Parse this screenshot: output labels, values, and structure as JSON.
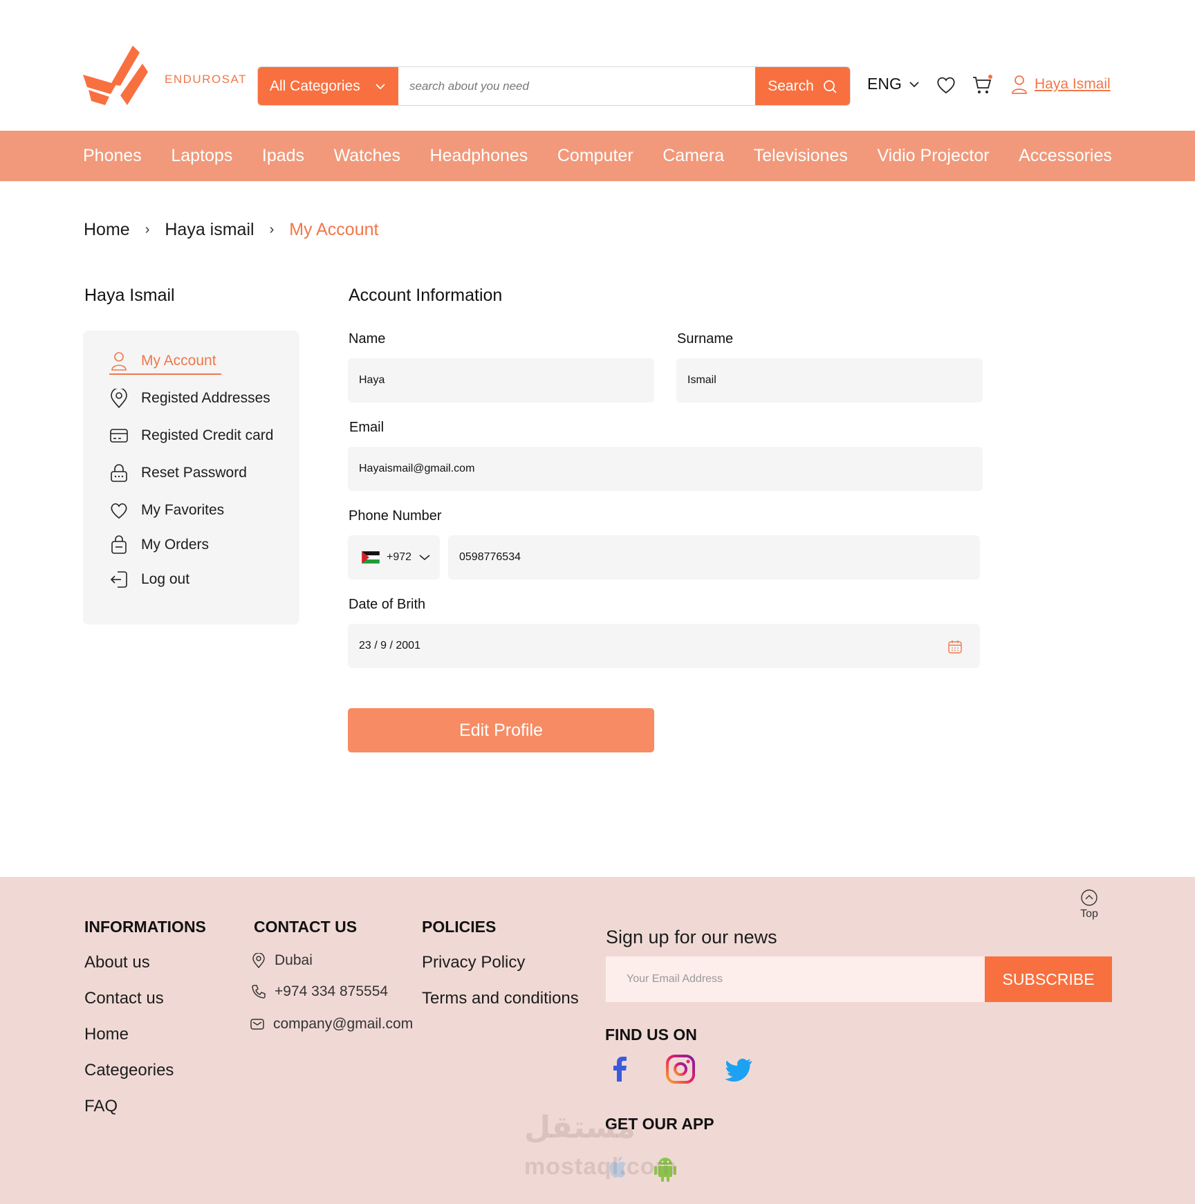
{
  "header": {
    "brand": "ENDUROSAT",
    "category_button": "All Categories",
    "search_placeholder": "search about you need",
    "search_button": "Search",
    "language": "ENG",
    "user_name": "Haya Ismail"
  },
  "nav": {
    "items": [
      "Phones",
      "Laptops",
      "Ipads",
      "Watches",
      "Headphones",
      "Computer",
      "Camera",
      "Televisiones",
      "Vidio Projector",
      "Accessories"
    ]
  },
  "breadcrumb": {
    "home": "Home",
    "user": "Haya ismail",
    "current": "My Account",
    "separator": "›"
  },
  "sidebar": {
    "title": "Haya Ismail",
    "items": [
      {
        "label": "My Account",
        "icon": "user-icon"
      },
      {
        "label": "Registed Addresses",
        "icon": "location-pin-icon"
      },
      {
        "label": "Registed Credit card",
        "icon": "credit-card-icon"
      },
      {
        "label": "Reset Password",
        "icon": "lock-icon"
      },
      {
        "label": "My Favorites",
        "icon": "heart-icon"
      },
      {
        "label": "My Orders",
        "icon": "bag-icon"
      },
      {
        "label": "Log out",
        "icon": "logout-icon"
      }
    ]
  },
  "form": {
    "title": "Account Information",
    "name_label": "Name",
    "name_value": "Haya",
    "surname_label": "Surname",
    "surname_value": "Ismail",
    "email_label": "Email",
    "email_value": "Hayaismail@gmail.com",
    "phone_label": "Phone Number",
    "phone_code": "+972",
    "phone_value": "0598776534",
    "dob_label": "Date of Brith",
    "dob_value": "23 / 9 / 2001",
    "edit_button": "Edit Profile"
  },
  "footer": {
    "info_title": "INFORMATIONS",
    "info_links": [
      "About us",
      "Contact us",
      "Home",
      "Categeories",
      "FAQ"
    ],
    "contact_title": "CONTACT US",
    "contact_city": "Dubai",
    "contact_phone": "+974 334 875554",
    "contact_email": "company@gmail.com",
    "policies_title": "POLICIES",
    "policies_links": [
      "Privacy Policy",
      "Terms and conditions"
    ],
    "top_label": "Top",
    "signup_title": "Sign up for our news",
    "email_placeholder": "Your Email Address",
    "subscribe_button": "SUBSCRIBE",
    "find_us_title": "FIND US ON",
    "get_app_title": "GET OUR APP",
    "watermark_arabic": "مستقل",
    "watermark_latin": "mostaql.com"
  },
  "colors": {
    "accent": "#f8703f",
    "nav_bg": "#f1997a",
    "footer_bg": "#f0d9d5",
    "field_bg": "#f5f5f5"
  }
}
